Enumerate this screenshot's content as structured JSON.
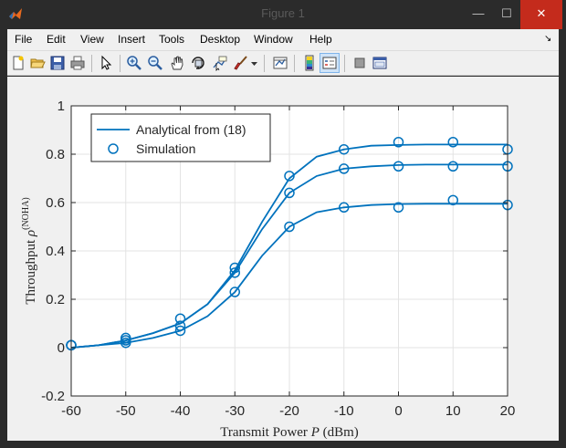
{
  "window": {
    "title": "Figure 1",
    "minimize_glyph": "—",
    "maximize_glyph": "☐",
    "close_glyph": "✕"
  },
  "menu": {
    "items": [
      "File",
      "Edit",
      "View",
      "Insert",
      "Tools",
      "Desktop",
      "Window",
      "Help"
    ],
    "dock_glyph": "↘"
  },
  "toolbar": {
    "icons": [
      "new-figure-icon",
      "open-file-icon",
      "save-icon",
      "print-icon",
      "pointer-icon",
      "zoom-in-icon",
      "zoom-out-icon",
      "pan-hand-icon",
      "rotate-3d-icon",
      "data-cursor-icon",
      "brush-icon",
      "brush-dropdown-icon",
      "link-plot-icon",
      "colorbar-icon",
      "legend-icon",
      "hide-plot-tools-icon",
      "show-plot-tools-icon"
    ],
    "pressed": "legend-icon"
  },
  "chart_data": {
    "type": "line",
    "xlabel_prefix": "Transmit Power ",
    "xlabel_var": "P",
    "xlabel_suffix": " (dBm)",
    "ylabel_prefix": "Throughput ",
    "ylabel_var": "ρ",
    "ylabel_sup": "(NOHA)",
    "xlim": [
      -60,
      20
    ],
    "ylim": [
      -0.2,
      1
    ],
    "xticks": [
      -60,
      -50,
      -40,
      -30,
      -20,
      -10,
      0,
      10,
      20
    ],
    "yticks": [
      -0.2,
      0,
      0.2,
      0.4,
      0.6,
      0.8,
      1
    ],
    "grid": true,
    "legend_position": "top-left",
    "line_color": "#0072bd",
    "legend": [
      {
        "label": "Analytical from (18)",
        "style": "line"
      },
      {
        "label": "Simulation",
        "style": "marker"
      }
    ],
    "analytical": [
      {
        "x": [
          -60,
          -55,
          -50,
          -45,
          -40,
          -35,
          -30,
          -25,
          -20,
          -15,
          -10,
          -5,
          0,
          5,
          10,
          15,
          20
        ],
        "y": [
          0.0,
          0.01,
          0.03,
          0.06,
          0.1,
          0.18,
          0.32,
          0.52,
          0.7,
          0.79,
          0.82,
          0.835,
          0.838,
          0.84,
          0.84,
          0.84,
          0.84
        ]
      },
      {
        "x": [
          -60,
          -55,
          -50,
          -45,
          -40,
          -35,
          -30,
          -25,
          -20,
          -15,
          -10,
          -5,
          0,
          5,
          10,
          15,
          20
        ],
        "y": [
          0.0,
          0.01,
          0.03,
          0.06,
          0.1,
          0.18,
          0.31,
          0.49,
          0.64,
          0.71,
          0.74,
          0.75,
          0.755,
          0.757,
          0.757,
          0.757,
          0.757
        ]
      },
      {
        "x": [
          -60,
          -55,
          -50,
          -45,
          -40,
          -35,
          -30,
          -25,
          -20,
          -15,
          -10,
          -5,
          0,
          5,
          10,
          15,
          20
        ],
        "y": [
          0.0,
          0.01,
          0.02,
          0.04,
          0.07,
          0.13,
          0.23,
          0.38,
          0.5,
          0.56,
          0.58,
          0.59,
          0.594,
          0.595,
          0.595,
          0.595,
          0.595
        ]
      }
    ],
    "simulation": [
      {
        "x": [
          -60,
          -50,
          -40,
          -30,
          -20,
          -10,
          0,
          10,
          20
        ],
        "y": [
          0.01,
          0.04,
          0.12,
          0.33,
          0.71,
          0.82,
          0.85,
          0.85,
          0.82
        ]
      },
      {
        "x": [
          -60,
          -50,
          -40,
          -30,
          -20,
          -10,
          0,
          10,
          20
        ],
        "y": [
          0.01,
          0.03,
          0.09,
          0.31,
          0.64,
          0.74,
          0.75,
          0.75,
          0.75
        ]
      },
      {
        "x": [
          -60,
          -50,
          -40,
          -30,
          -20,
          -10,
          0,
          10,
          20
        ],
        "y": [
          0.01,
          0.02,
          0.07,
          0.23,
          0.5,
          0.58,
          0.58,
          0.61,
          0.59
        ]
      }
    ]
  }
}
